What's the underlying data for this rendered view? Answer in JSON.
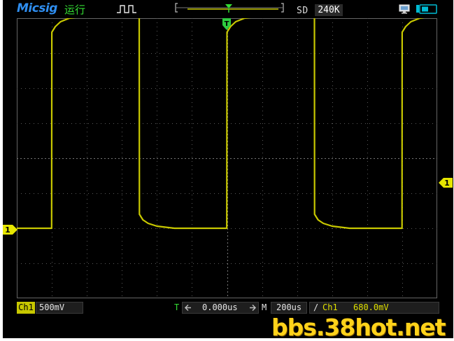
{
  "header": {
    "brand": "Micsig",
    "run_state": "运行",
    "sample_mode": "SD",
    "memory_depth": "240K"
  },
  "icons": {
    "waveform": "square-wave-icon",
    "monitor": "monitor-icon",
    "battery": "battery-icon"
  },
  "markers": {
    "channel": "1",
    "trigger_level": "1",
    "trigger_position": "T"
  },
  "footer": {
    "channel_label": "Ch1",
    "volts_per_div": "500mV",
    "trigger_delay_label": "T",
    "trigger_delay": "0.000us",
    "timebase_label": "M",
    "time_per_div": "200us",
    "trigger_slope": "/",
    "trigger_source": "Ch1",
    "trigger_voltage": "680.0mV"
  },
  "watermark": "bbs.38hot.net",
  "colors": {
    "trace": "#c8c800",
    "grid": "#5a5a5a",
    "brand": "#2f8ef0",
    "run": "#33dd33",
    "watermark": "#ffd21a"
  },
  "chart_data": {
    "type": "line",
    "x_unit": "us",
    "y_unit": "V",
    "xlim": [
      -1200,
      1200
    ],
    "ylim": [
      -2.0,
      2.0
    ],
    "grid": true,
    "period_us": 1000,
    "series": [
      {
        "name": "Ch1",
        "x": [
          -1200,
          -1001,
          -1000,
          -980,
          -950,
          -900,
          -800,
          -700,
          -600,
          -501,
          -500,
          -480,
          -450,
          -400,
          -300,
          -200,
          -1,
          0,
          20,
          50,
          100,
          200,
          300,
          400,
          499,
          500,
          520,
          550,
          600,
          700,
          800,
          999,
          1000,
          1020,
          1050,
          1100,
          1200
        ],
        "y": [
          -1.0,
          -1.0,
          1.8,
          1.88,
          1.95,
          2.0,
          2.03,
          2.04,
          2.04,
          2.04,
          -0.8,
          -0.88,
          -0.93,
          -0.97,
          -1.0,
          -1.0,
          -1.0,
          1.8,
          1.88,
          1.95,
          2.0,
          2.03,
          2.04,
          2.04,
          2.04,
          -0.8,
          -0.88,
          -0.93,
          -0.97,
          -1.0,
          -1.0,
          -1.0,
          1.8,
          1.88,
          1.95,
          2.0,
          2.04
        ]
      }
    ]
  }
}
